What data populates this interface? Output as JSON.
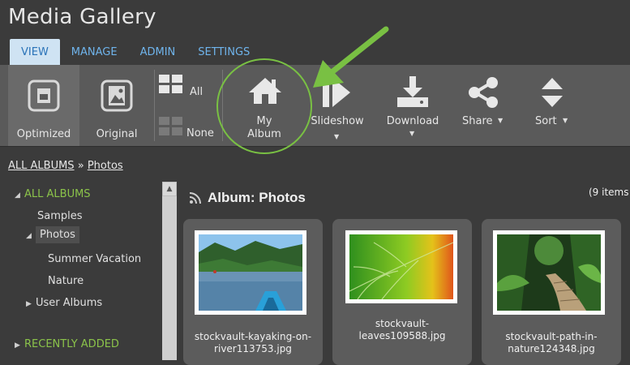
{
  "app": {
    "title": "Media Gallery"
  },
  "tabs": [
    {
      "label": "VIEW",
      "active": true
    },
    {
      "label": "MANAGE",
      "active": false
    },
    {
      "label": "ADMIN",
      "active": false
    },
    {
      "label": "SETTINGS",
      "active": false
    }
  ],
  "ribbon": {
    "optimized": "Optimized",
    "original": "Original",
    "all": "All",
    "none": "None",
    "my_album_line1": "My",
    "my_album_line2": "Album",
    "slideshow": "Slideshow",
    "download": "Download",
    "share": "Share",
    "sort": "Sort"
  },
  "breadcrumb": {
    "root": "ALL ALBUMS",
    "separator": "»",
    "current": "Photos"
  },
  "sidebar": {
    "all_albums": "ALL ALBUMS",
    "samples": "Samples",
    "photos": "Photos",
    "summer_vacation": "Summer Vacation",
    "nature": "Nature",
    "user_albums": "User Albums",
    "recently_added": "RECENTLY ADDED"
  },
  "album": {
    "title": "Album: Photos",
    "count": "(9 items"
  },
  "thumbnails": [
    {
      "line1": "stockvault-kayaking-on-",
      "line2": "river113753.jpg"
    },
    {
      "line1": "stockvault-",
      "line2": "leaves109588.jpg"
    },
    {
      "line1": "stockvault-path-in-",
      "line2": "nature124348.jpg"
    }
  ],
  "colors": {
    "accent_green": "#79c043",
    "tab_blue": "#6fb4ec",
    "ribbon_bg": "#5a5a5a"
  }
}
